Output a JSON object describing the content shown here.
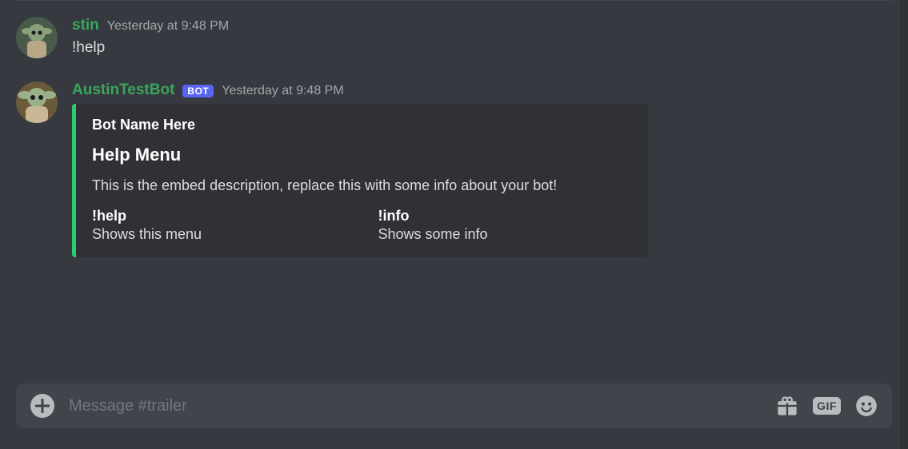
{
  "messages": [
    {
      "username": "stin",
      "username_color": "green",
      "timestamp": "Yesterday at 9:48 PM",
      "content": "!help",
      "is_bot": false
    },
    {
      "username": "AustinTestBot",
      "username_color": "green",
      "timestamp": "Yesterday at 9:48 PM",
      "is_bot": true,
      "bot_tag": "BOT",
      "embed": {
        "accent_color": "#2ecc71",
        "author": "Bot Name Here",
        "title": "Help Menu",
        "description": "This is the embed description, replace this with some info about your bot!",
        "fields": [
          {
            "name": "!help",
            "value": "Shows this menu"
          },
          {
            "name": "!info",
            "value": "Shows some info"
          }
        ]
      }
    }
  ],
  "composer": {
    "placeholder": "Message #trailer",
    "gif_label": "GIF"
  }
}
